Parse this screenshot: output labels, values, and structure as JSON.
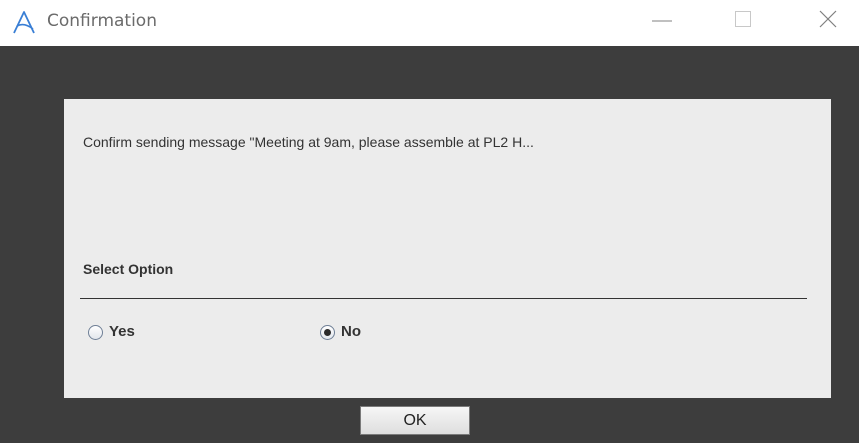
{
  "window": {
    "title": "Confirmation"
  },
  "dialog": {
    "message": "Confirm sending message \"Meeting at 9am, please assemble at PL2 H...",
    "section_label": "Select Option",
    "options": [
      {
        "label": "Yes",
        "selected": false
      },
      {
        "label": "No",
        "selected": true
      }
    ],
    "ok_label": "OK"
  },
  "colors": {
    "content_background": "#3d3d3d",
    "panel_background": "#ececec",
    "accent": "#3a7fd5"
  }
}
